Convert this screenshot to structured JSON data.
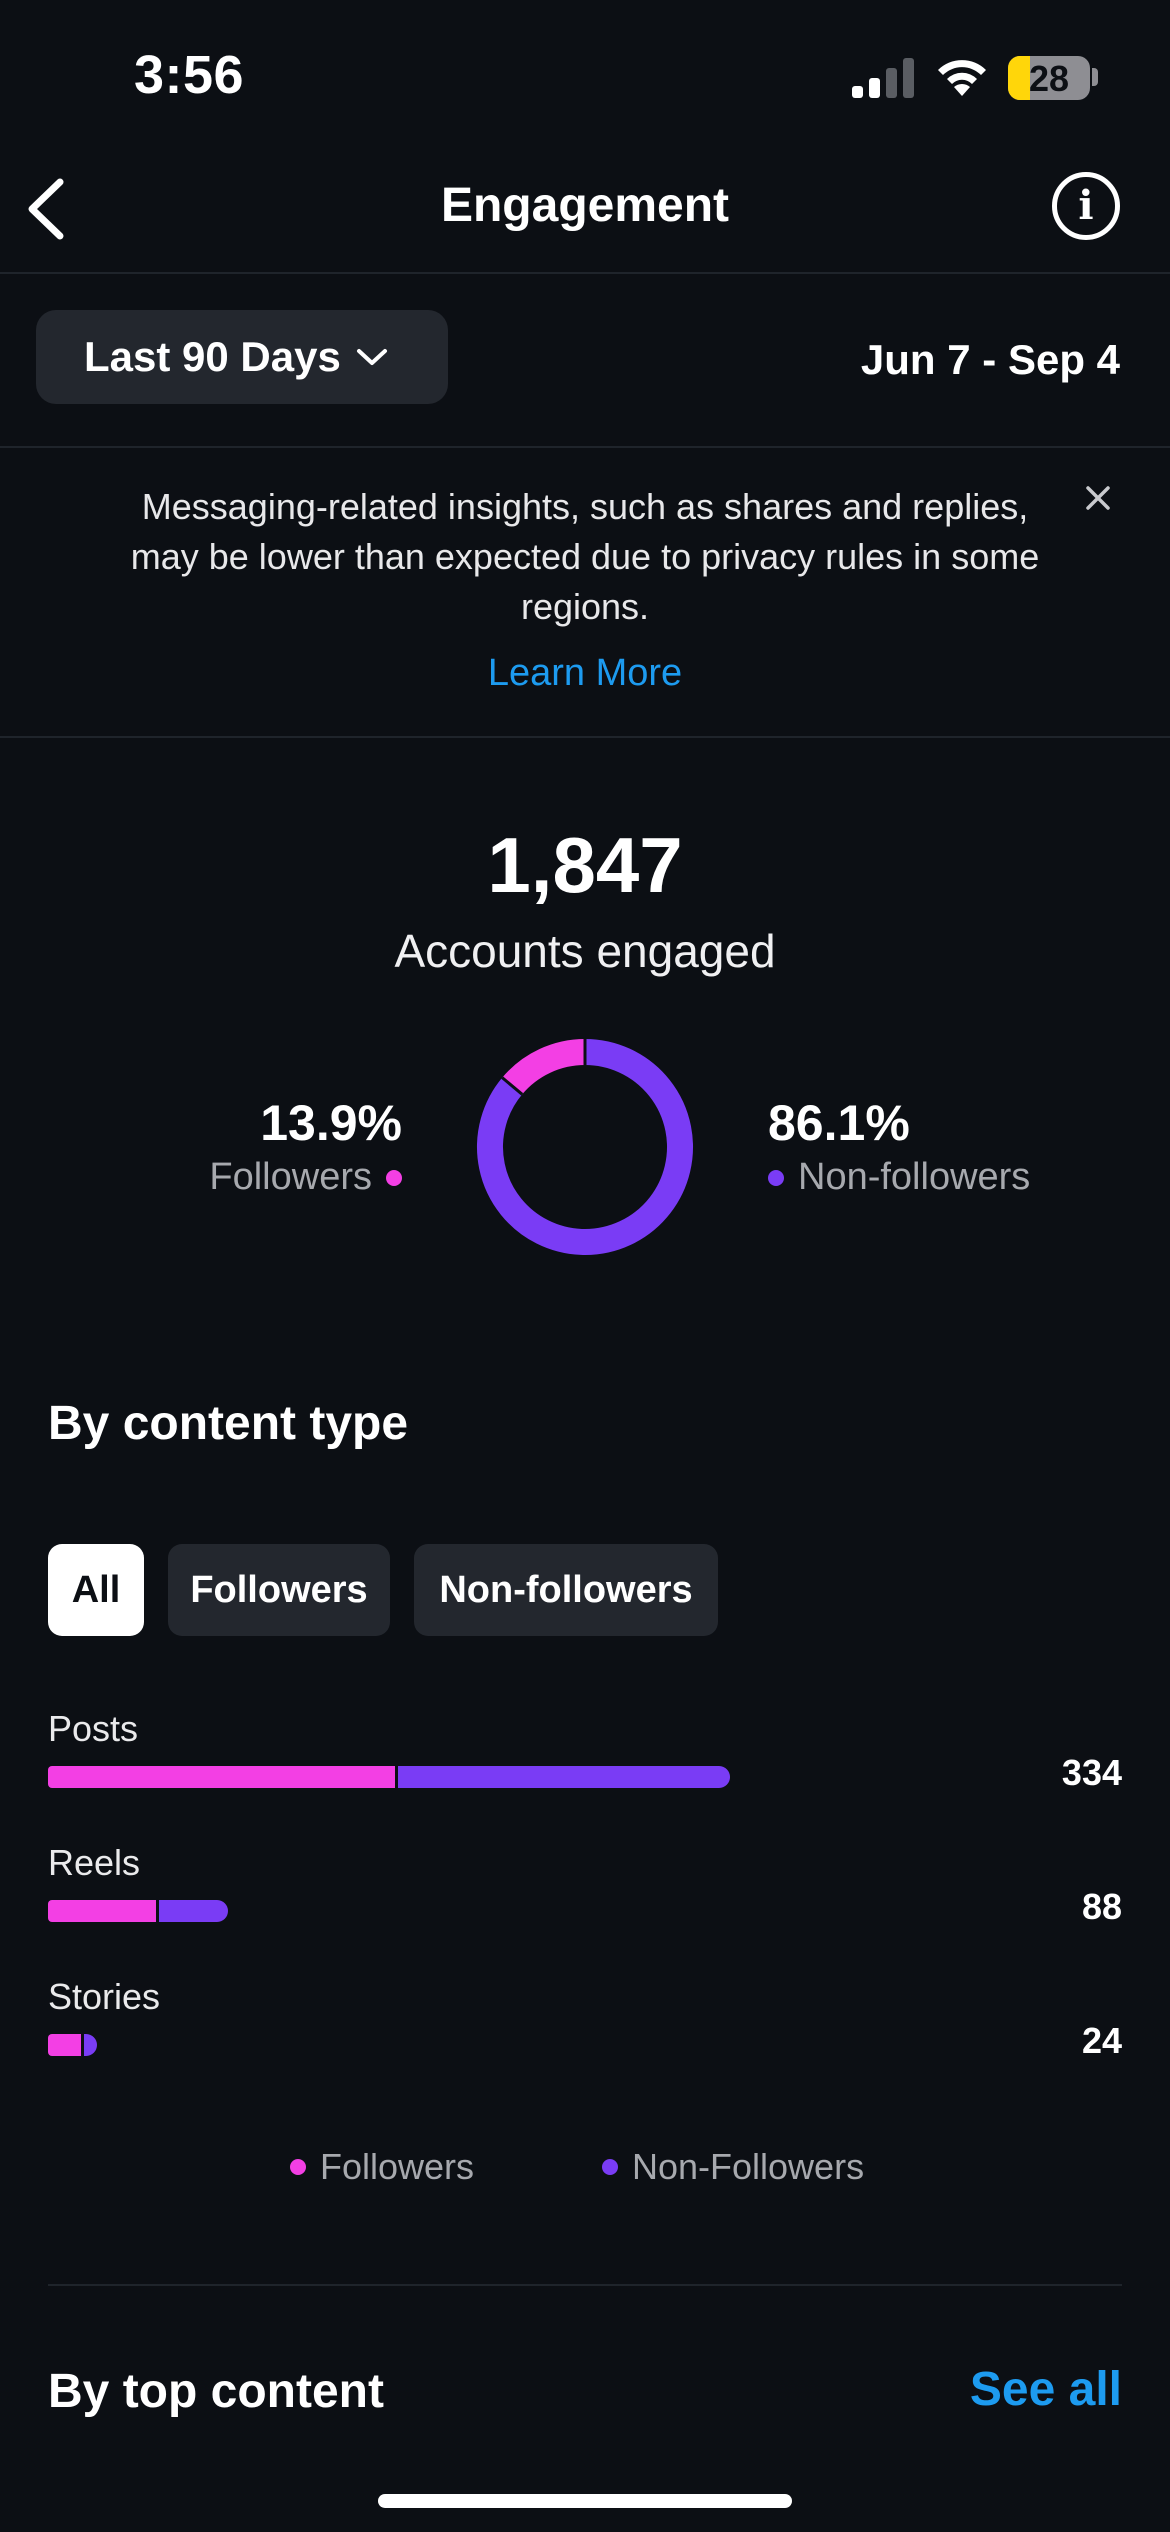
{
  "status_bar": {
    "time": "3:56",
    "battery": "28"
  },
  "nav": {
    "title": "Engagement"
  },
  "filter": {
    "range_label": "Last 90 Days",
    "date_range": "Jun 7 - Sep 4"
  },
  "banner": {
    "text": "Messaging-related insights, such as shares and replies, may be lower than expected due to privacy rules in some regions.",
    "link": "Learn More"
  },
  "summary": {
    "value": "1,847",
    "label": "Accounts engaged",
    "followers_pct": "13.9%",
    "followers_label": "Followers",
    "non_followers_pct": "86.1%",
    "non_followers_label": "Non-followers"
  },
  "content_type": {
    "heading": "By content type",
    "tabs": [
      "All",
      "Followers",
      "Non-followers"
    ],
    "active_tab": "All",
    "rows": [
      {
        "label": "Posts",
        "value": "334"
      },
      {
        "label": "Reels",
        "value": "88"
      },
      {
        "label": "Stories",
        "value": "24"
      }
    ],
    "legend": [
      "Followers",
      "Non-Followers"
    ]
  },
  "top_content": {
    "heading": "By top content",
    "see_all": "See all"
  },
  "colors": {
    "followers": "#f33fe4",
    "non_followers": "#7a3cf5",
    "link": "#1d9bf0",
    "background": "#0c0f14"
  },
  "chart_data": [
    {
      "type": "pie",
      "categories": [
        "Followers",
        "Non-followers"
      ],
      "values": [
        13.9,
        86.1
      ]
    },
    {
      "type": "bar",
      "categories": [
        "Posts",
        "Reels",
        "Stories"
      ],
      "totals": [
        334,
        88,
        24
      ],
      "series": [
        {
          "name": "Followers",
          "values": [
            170,
            53,
            16
          ]
        },
        {
          "name": "Non-Followers",
          "values": [
            164,
            35,
            8
          ]
        }
      ]
    }
  ]
}
